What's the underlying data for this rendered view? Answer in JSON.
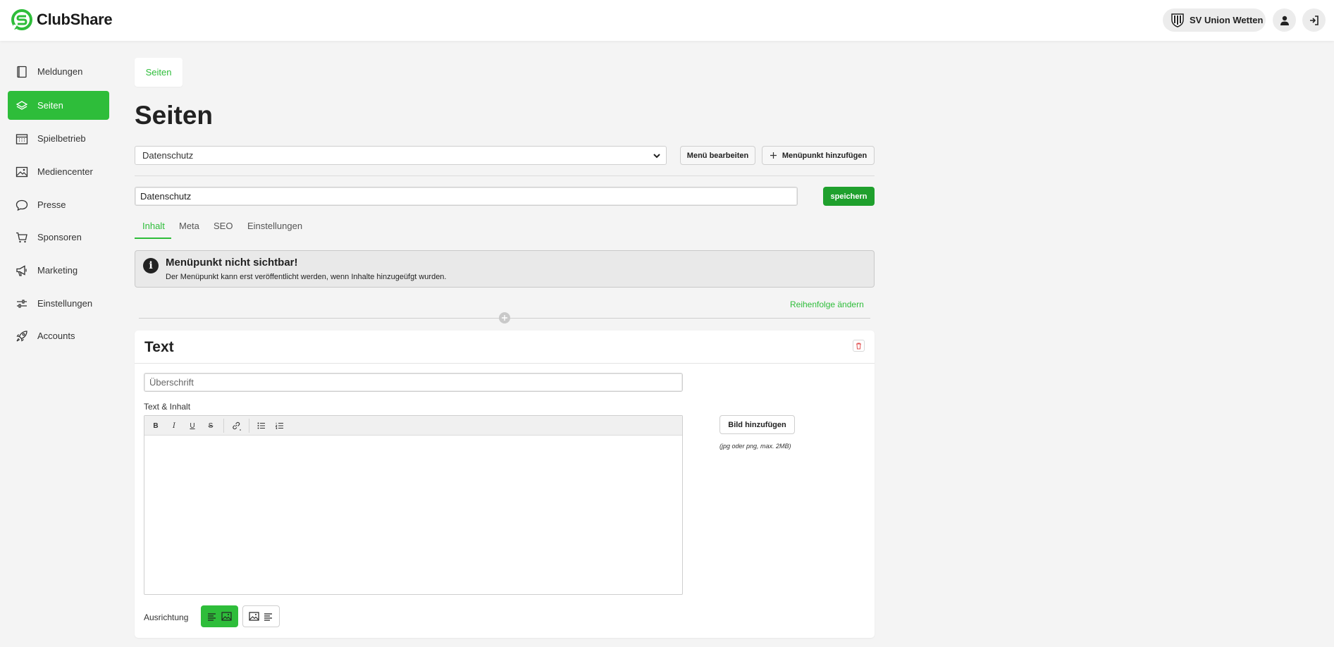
{
  "app": {
    "name": "ClubShare",
    "brand_color": "#2ebd3a",
    "club_name": "SV Union Wetten"
  },
  "header": {
    "user_icon": "user-icon",
    "logout_icon": "logout-icon"
  },
  "sidebar": {
    "items": [
      {
        "label": "Meldungen",
        "icon": "book-icon",
        "active": false
      },
      {
        "label": "Seiten",
        "icon": "layers-icon",
        "active": true
      },
      {
        "label": "Spielbetrieb",
        "icon": "calendar-icon",
        "active": false
      },
      {
        "label": "Mediencenter",
        "icon": "image-icon",
        "active": false
      },
      {
        "label": "Presse",
        "icon": "chat-icon",
        "active": false
      },
      {
        "label": "Sponsoren",
        "icon": "cart-icon",
        "active": false
      },
      {
        "label": "Marketing",
        "icon": "megaphone-icon",
        "active": false
      },
      {
        "label": "Einstellungen",
        "icon": "sliders-icon",
        "active": false
      },
      {
        "label": "Accounts",
        "icon": "rocket-icon",
        "active": false
      }
    ]
  },
  "breadcrumb": {
    "label": "Seiten"
  },
  "page": {
    "title": "Seiten"
  },
  "menu": {
    "selected": "Datenschutz",
    "edit_label": "Menü bearbeiten",
    "add_label": "Menüpunkt hinzufügen"
  },
  "page_form": {
    "title_value": "Datenschutz",
    "save_label": "speichern"
  },
  "tabs": [
    {
      "label": "Inhalt",
      "active": true
    },
    {
      "label": "Meta",
      "active": false
    },
    {
      "label": "SEO",
      "active": false
    },
    {
      "label": "Einstellungen",
      "active": false
    }
  ],
  "alert": {
    "title": "Menüpunkt nicht sichtbar!",
    "text": "Der Menüpunkt kann erst veröffentlicht werden, wenn Inhalte hinzugeüfgt wurden."
  },
  "content": {
    "reorder_label": "Reihenfolge ändern",
    "block": {
      "title": "Text",
      "heading_placeholder": "Überschrift",
      "text_label": "Text & Inhalt",
      "toolbar": {
        "bold": "B",
        "italic": "I",
        "underline": "U",
        "strike": "S"
      },
      "image_button": "Bild hinzufügen",
      "image_hint": "(jpg oder png, max. 2MB)",
      "alignment_label": "Ausrichtung"
    }
  }
}
